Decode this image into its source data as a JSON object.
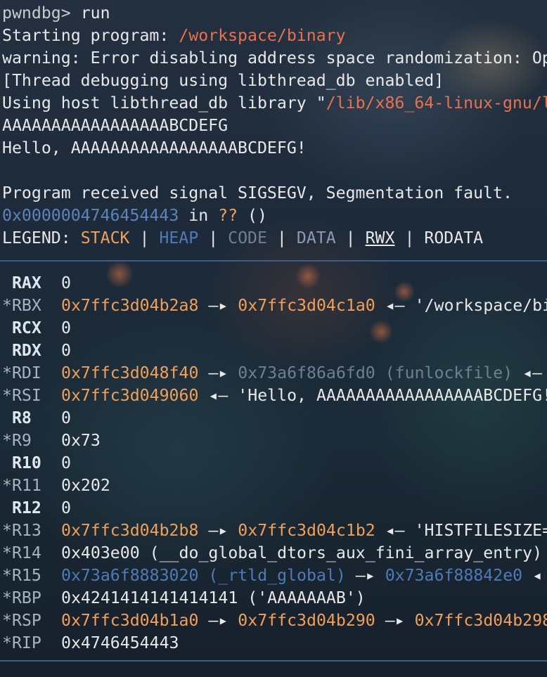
{
  "console": {
    "prompt": "pwndbg>",
    "command": "run",
    "starting_label": "Starting program: ",
    "starting_path": "/workspace/binary",
    "warning": "warning: Error disabling address space randomization: Op",
    "thread_debug": "[Thread debugging using libthread_db enabled]",
    "using_host_label": "Using host libthread_db library \"",
    "using_host_path": "/lib/x86_64-linux-gnu/l",
    "input_echo": "AAAAAAAAAAAAAAAAABCDEFG",
    "hello_output": "Hello, AAAAAAAAAAAAAAAAABCDEFG!",
    "signal": "Program received signal SIGSEGV, Segmentation fault.",
    "fault_addr": "0x0000004746454443",
    "fault_in": " in ",
    "fault_sym": "??",
    "fault_args": " ()"
  },
  "legend": {
    "label": "LEGEND: ",
    "sep": " | ",
    "stack": "STACK",
    "heap": "HEAP",
    "code": "CODE",
    "data": "DATA",
    "rwx": "RWX",
    "rodata": "RODATA"
  },
  "registers": {
    "rax": {
      "name": " RAX",
      "v1": "0"
    },
    "rbx": {
      "name": "*RBX",
      "v1": "0x7ffc3d04b2a8",
      "a1": " —▸ ",
      "v2": "0x7ffc3d04c1a0",
      "a2": " ◂— ",
      "v3": "'/workspace/bi"
    },
    "rcx": {
      "name": " RCX",
      "v1": "0"
    },
    "rdx": {
      "name": " RDX",
      "v1": "0"
    },
    "rdi": {
      "name": "*RDI",
      "v1": "0x7ffc3d048f40",
      "a1": " —▸ ",
      "v2": "0x73a6f86a6fd0 (funlockfile)",
      "a2": " ◂—"
    },
    "rsi": {
      "name": "*RSI",
      "v1": "0x7ffc3d049060",
      "a1": " ◂— ",
      "v2": "'Hello, AAAAAAAAAAAAAAAAABCDEFG!"
    },
    "r8": {
      "name": " R8",
      "v1": "0"
    },
    "r9": {
      "name": "*R9",
      "v1": "0x73"
    },
    "r10": {
      "name": " R10",
      "v1": "0"
    },
    "r11": {
      "name": "*R11",
      "v1": "0x202"
    },
    "r12": {
      "name": " R12",
      "v1": "0"
    },
    "r13": {
      "name": "*R13",
      "v1": "0x7ffc3d04b2b8",
      "a1": " —▸ ",
      "v2": "0x7ffc3d04c1b2",
      "a2": " ◂— ",
      "v3": "'HISTFILESIZE="
    },
    "r14": {
      "name": "*R14",
      "v1": "0x403e00 (__do_global_dtors_aux_fini_array_entry)"
    },
    "r15": {
      "name": "*R15",
      "v1": "0x73a6f8883020 (_rtld_global)",
      "a1": " —▸ ",
      "v2": "0x73a6f88842e0",
      "a2": " ◂"
    },
    "rbp": {
      "name": "*RBP",
      "v1": "0x4241414141414141 ('AAAAAAAB')"
    },
    "rsp": {
      "name": "*RSP",
      "v1": "0x7ffc3d04b1a0",
      "a1": " —▸ ",
      "v2": "0x7ffc3d04b290",
      "a2": " —▸ ",
      "v3": "0x7ffc3d04b298"
    },
    "rip": {
      "name": "*RIP",
      "v1": "0x4746454443"
    }
  },
  "colors": {
    "stack": "#f0a05a",
    "heap": "#4f7bb4",
    "code": "#6f7f94",
    "data": "#8a9ab4",
    "path": "#e8714e",
    "rule": "#3b5d86"
  }
}
